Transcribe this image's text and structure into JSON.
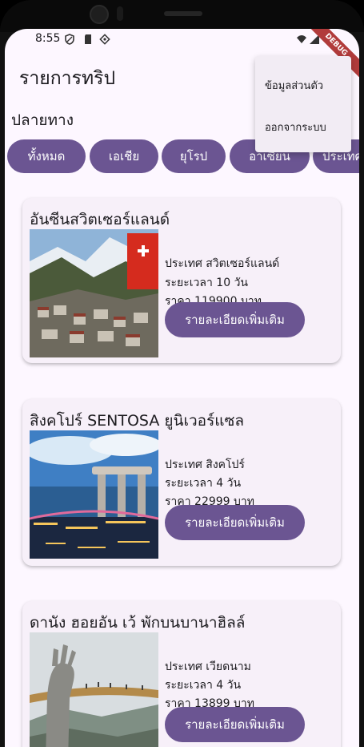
{
  "status": {
    "time": "8:55",
    "debug": "DEBUG"
  },
  "appbar": {
    "title": "รายการทริป"
  },
  "menu": {
    "items": [
      "ข้อมูลส่วนตัว",
      "ออกจากระบบ"
    ]
  },
  "filter": {
    "label": "ปลายทาง",
    "chips": [
      "ทั้งหมด",
      "เอเชีย",
      "ยุโรป",
      "อาเซียน",
      "ประเทศ"
    ]
  },
  "trips": [
    {
      "title": "อันซีนสวิตเซอร์แลนด์",
      "country": "ประเทศ สวิตเซอร์แลนด์",
      "duration": "ระยะเวลา 10 วัน",
      "price": "ราคา 119900 บาท",
      "button": "รายละเอียดเพิ่มเติม"
    },
    {
      "title": "สิงคโปร์ SENTOSA ยูนิเวอร์แซล",
      "country": "ประเทศ สิงคโปร์",
      "duration": "ระยะเวลา 4 วัน",
      "price": "ราคา 22999 บาท",
      "button": "รายละเอียดเพิ่มเติม"
    },
    {
      "title": "ดานัง ฮอยอัน เว้ พักบนบานาฮิลล์",
      "country": "ประเทศ เวียดนาม",
      "duration": "ระยะเวลา 4 วัน",
      "price": "ราคา 13899 บาท",
      "button": "รายละเอียดเพิ่มเติม"
    }
  ],
  "colors": {
    "primary": "#6b5592",
    "background": "#fdf7ff",
    "card": "#f7f0f9",
    "menu": "#f2ecf4"
  }
}
